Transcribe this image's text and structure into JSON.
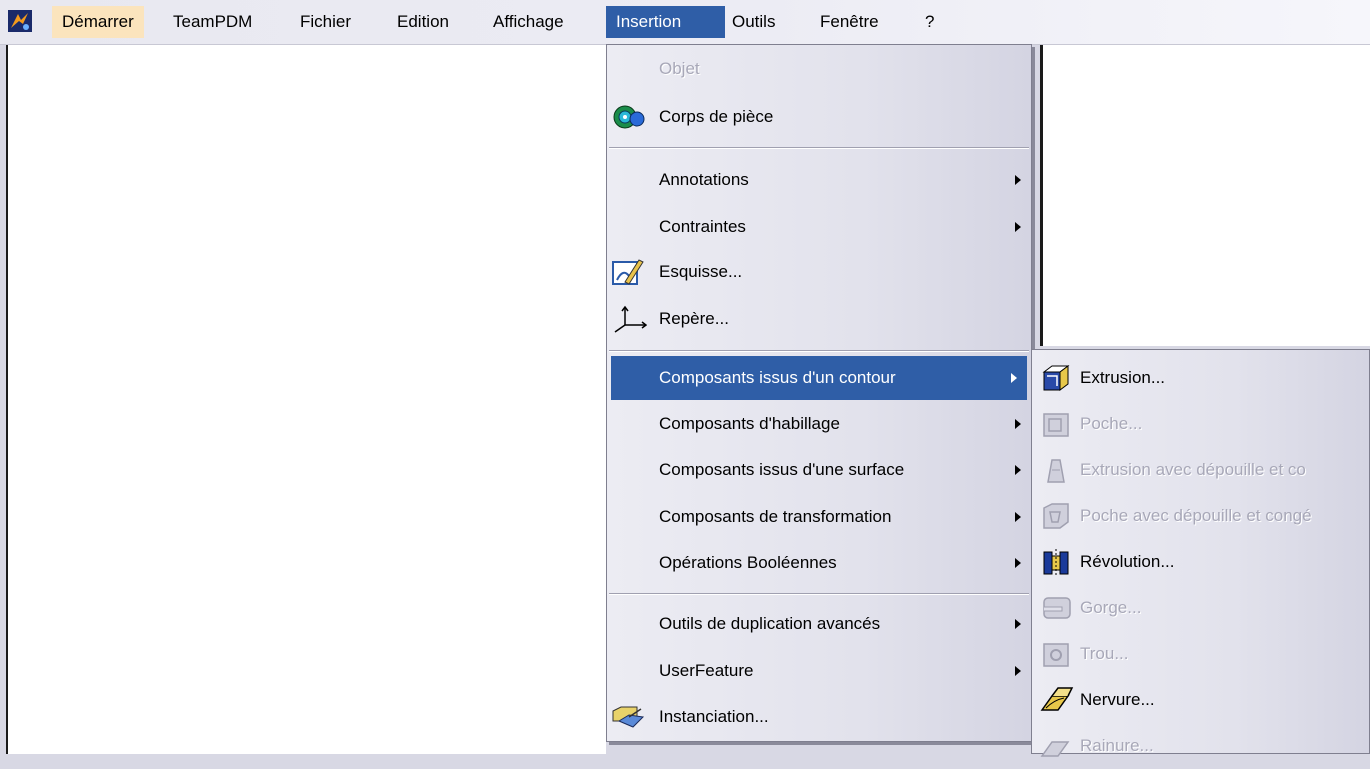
{
  "menubar": {
    "items": [
      {
        "label": "Démarrer"
      },
      {
        "label": "TeamPDM"
      },
      {
        "label": "Fichier"
      },
      {
        "label": "Edition"
      },
      {
        "label": "Affichage"
      },
      {
        "label": "Insertion"
      },
      {
        "label": "Outils"
      },
      {
        "label": "Fenêtre"
      },
      {
        "label": "?"
      }
    ]
  },
  "insertion_menu": {
    "items": [
      {
        "label": "Objet",
        "icon": "none",
        "disabled": true
      },
      {
        "label": "Corps de pièce",
        "icon": "part-body-icon"
      },
      {
        "label": "Annotations",
        "submenu": true
      },
      {
        "label": "Contraintes",
        "submenu": true
      },
      {
        "label": "Esquisse...",
        "icon": "sketch-icon"
      },
      {
        "label": "Repère...",
        "icon": "axis-system-icon"
      },
      {
        "label": "Composants issus d'un contour",
        "submenu": true,
        "selected": true
      },
      {
        "label": "Composants d'habillage",
        "submenu": true
      },
      {
        "label": "Composants issus d'une surface",
        "submenu": true
      },
      {
        "label": "Composants de transformation",
        "submenu": true
      },
      {
        "label": "Opérations Booléennes",
        "submenu": true
      },
      {
        "label": "Outils de duplication avancés",
        "submenu": true
      },
      {
        "label": "UserFeature",
        "submenu": true
      },
      {
        "label": "Instanciation...",
        "icon": "instantiation-icon"
      }
    ]
  },
  "contour_submenu": {
    "items": [
      {
        "label": "Extrusion...",
        "icon": "pad-icon"
      },
      {
        "label": "Poche...",
        "icon": "pocket-icon",
        "disabled": true
      },
      {
        "label": "Extrusion avec dépouille et co",
        "icon": "drafted-pad-icon",
        "disabled": true
      },
      {
        "label": "Poche avec dépouille et congé",
        "icon": "drafted-pocket-icon",
        "disabled": true
      },
      {
        "label": "Révolution...",
        "icon": "shaft-icon"
      },
      {
        "label": "Gorge...",
        "icon": "groove-icon",
        "disabled": true
      },
      {
        "label": "Trou...",
        "icon": "hole-icon",
        "disabled": true
      },
      {
        "label": "Nervure...",
        "icon": "rib-icon"
      },
      {
        "label": "Rainure...",
        "icon": "slot-icon",
        "disabled": true
      }
    ]
  },
  "colors": {
    "selection": "#2f5ea7",
    "hover_highlight": "#fbe4bd",
    "disabled_text": "#a8a8b8"
  }
}
